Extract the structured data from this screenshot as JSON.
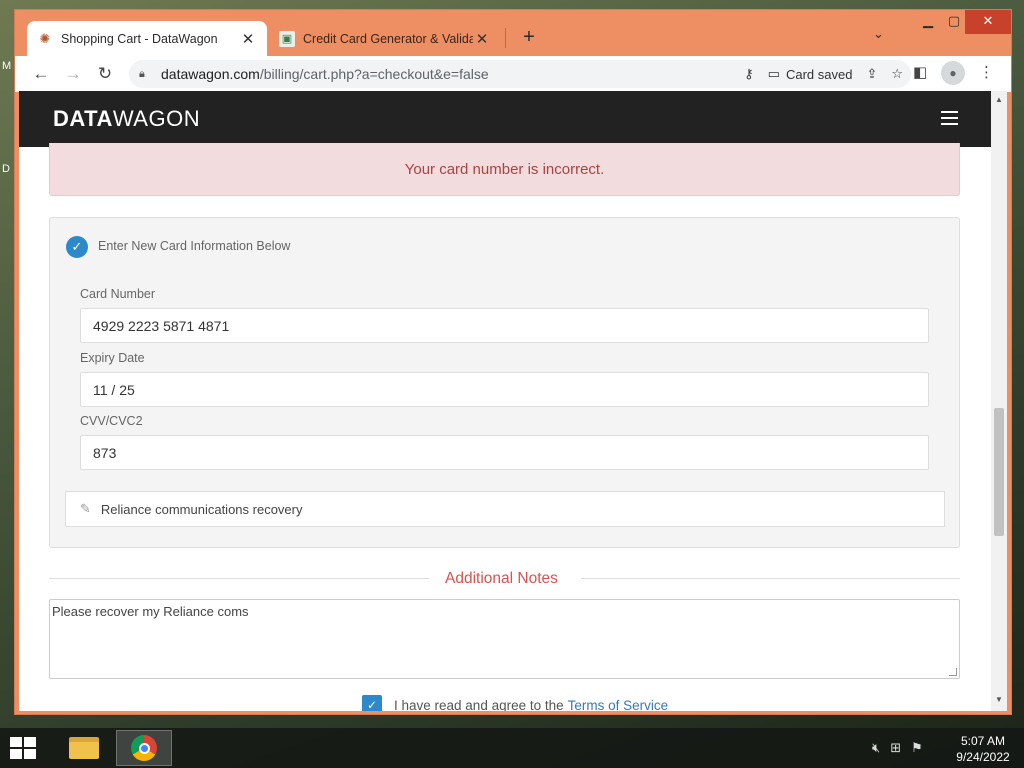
{
  "desktop": {
    "edge_glyph_top": "M",
    "edge_glyph_mid": "D"
  },
  "browser": {
    "tabs": [
      {
        "title": "Shopping Cart - DataWagon",
        "icon": "datawagon-favicon",
        "active": true
      },
      {
        "title": "Credit Card Generator & Validator",
        "icon": "ccgen-favicon",
        "active": false
      }
    ],
    "new_tab_label": "+",
    "url_host": "datawagon.com",
    "url_path": "/billing/cart.php?a=checkout&e=false",
    "card_saved_label": "Card saved"
  },
  "site": {
    "logo_bold": "DATA",
    "logo_light": "WAGON",
    "alert_text": "Your card number is incorrect.",
    "new_card_option": "Enter New Card Information Below",
    "card_number_label": "Card Number",
    "card_number_value": "4929 2223 5871 4871",
    "expiry_label": "Expiry Date",
    "expiry_value": "11 / 25",
    "cvv_label": "CVV/CVC2",
    "cvv_value": "873",
    "card_description": "Reliance communications recovery",
    "notes_heading": "Additional Notes",
    "notes_value": "Please recover my Reliance coms",
    "tos_text": "I have read and agree to the",
    "tos_link": "Terms of Service"
  },
  "taskbar": {
    "time": "5:07 AM",
    "date": "9/24/2022"
  },
  "colors": {
    "accent": "#2d89c9",
    "alert_bg": "#f3dcde",
    "alert_text": "#a94442",
    "notes_heading": "#d9534f",
    "header_bg": "#222222",
    "window_frame": "#ee8f63"
  }
}
